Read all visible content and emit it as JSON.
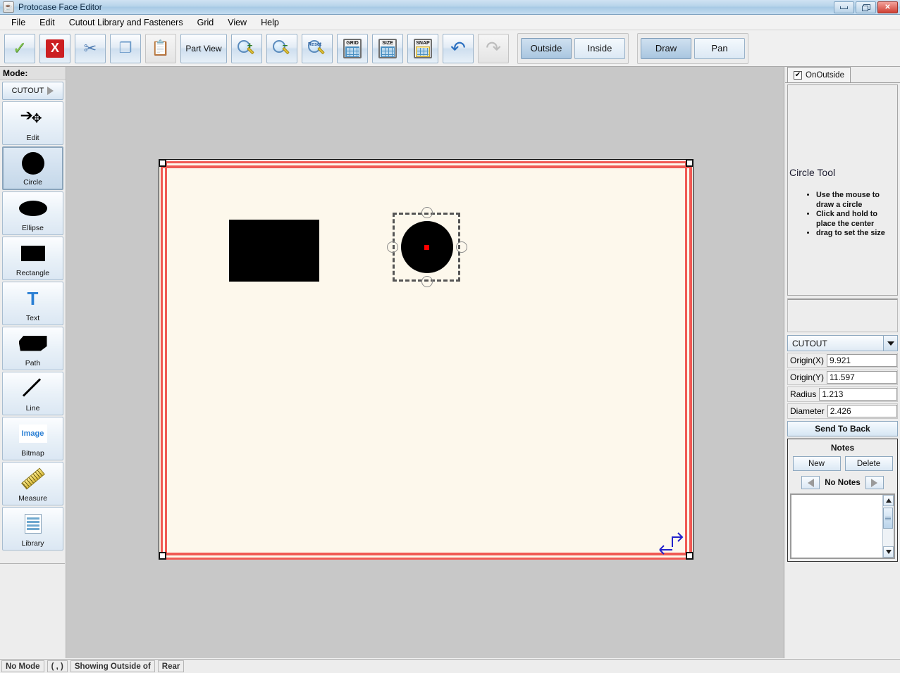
{
  "window": {
    "title": "Protocase Face Editor",
    "app_icon": "java-cup-icon",
    "buttons": {
      "minimize": "minimize",
      "maximize": "maximize",
      "close": "close"
    }
  },
  "menubar": {
    "items": [
      {
        "label": "File",
        "mnemonic": "F"
      },
      {
        "label": "Edit",
        "mnemonic": "E"
      },
      {
        "label": "Cutout Library and Fasteners",
        "mnemonic": "L"
      },
      {
        "label": "Grid",
        "mnemonic": "d"
      },
      {
        "label": "View",
        "mnemonic": "V"
      },
      {
        "label": "Help",
        "mnemonic": "H"
      }
    ]
  },
  "toolbar": {
    "buttons": [
      {
        "name": "accept-button",
        "icon": "green-check-icon",
        "label": ""
      },
      {
        "name": "cancel-button",
        "icon": "red-x-icon",
        "label": ""
      },
      {
        "name": "cut-button",
        "icon": "scissors-icon",
        "label": ""
      },
      {
        "name": "copy-button",
        "icon": "copy-icon",
        "label": ""
      },
      {
        "name": "paste-button",
        "icon": "paste-icon",
        "label": "",
        "disabled": true
      },
      {
        "name": "part-view-button",
        "icon": "",
        "label": "Part View"
      },
      {
        "name": "zoom-in-button",
        "icon": "magnifier-plus-icon",
        "label": ""
      },
      {
        "name": "zoom-out-button",
        "icon": "magnifier-minus-icon",
        "label": ""
      },
      {
        "name": "zoom-reset-button",
        "icon": "magnifier-reset-icon",
        "label": "Reset"
      },
      {
        "name": "grid-button",
        "icon": "grid-icon",
        "label": "GRID"
      },
      {
        "name": "size-button",
        "icon": "size-icon",
        "label": "SIZE"
      },
      {
        "name": "snap-button",
        "icon": "snap-icon",
        "label": "SNAP"
      },
      {
        "name": "undo-button",
        "icon": "undo-arrow-icon",
        "label": ""
      },
      {
        "name": "redo-button",
        "icon": "redo-arrow-icon",
        "label": "",
        "disabled": true
      }
    ],
    "side_group": {
      "outside": "Outside",
      "inside": "Inside",
      "selected": "Outside"
    },
    "mode_group": {
      "draw": "Draw",
      "pan": "Pan",
      "selected": "Draw"
    }
  },
  "sidebar": {
    "mode_label": "Mode:",
    "cutout_button": "CUTOUT",
    "selected_tool": "Circle",
    "tools": [
      {
        "label": "Edit",
        "icon": "cursor-move-icon"
      },
      {
        "label": "Circle",
        "icon": "circle-icon"
      },
      {
        "label": "Ellipse",
        "icon": "ellipse-icon"
      },
      {
        "label": "Rectangle",
        "icon": "rectangle-icon"
      },
      {
        "label": "Text",
        "icon": "text-t-icon"
      },
      {
        "label": "Path",
        "icon": "path-polygon-icon"
      },
      {
        "label": "Line",
        "icon": "line-icon"
      },
      {
        "label": "Bitmap",
        "icon": "image-icon"
      },
      {
        "label": "Measure",
        "icon": "ruler-icon"
      },
      {
        "label": "Library",
        "icon": "list-icon"
      }
    ]
  },
  "canvas": {
    "sheet_color": "#fdf8ec",
    "border_color": "#f05a54",
    "background": "#c8c8c8",
    "shapes": [
      {
        "type": "rectangle",
        "fill": "#000000"
      },
      {
        "type": "circle",
        "fill": "#000000",
        "selected": true,
        "center_marker_color": "#ff0000"
      }
    ]
  },
  "right_panel": {
    "tab": {
      "label": "OnOutside",
      "checked": true,
      "check_glyph": "✔"
    },
    "help": {
      "title": "Circle Tool",
      "bullets": [
        "Use the mouse to draw a circle",
        "Click and hold to place the center",
        "drag to set the size"
      ]
    },
    "type_combo": {
      "value": "CUTOUT"
    },
    "fields": [
      {
        "name": "origin-x",
        "label": "Origin(X)",
        "value": "9.921"
      },
      {
        "name": "origin-y",
        "label": "Origin(Y)",
        "value": "11.597"
      },
      {
        "name": "radius",
        "label": "Radius",
        "value": "1.213"
      },
      {
        "name": "diameter",
        "label": "Diameter",
        "value": "2.426"
      }
    ],
    "send_to_back": "Send To Back",
    "notes": {
      "title": "Notes",
      "new_label": "New",
      "delete_label": "Delete",
      "counter": "No Notes",
      "text_value": ""
    }
  },
  "statusbar": {
    "cells": [
      {
        "name": "status-mode",
        "text": "No Mode"
      },
      {
        "name": "status-coords",
        "text": "( , )"
      },
      {
        "name": "status-showing",
        "text": "Showing Outside of"
      },
      {
        "name": "status-face",
        "text": "Rear"
      }
    ]
  }
}
